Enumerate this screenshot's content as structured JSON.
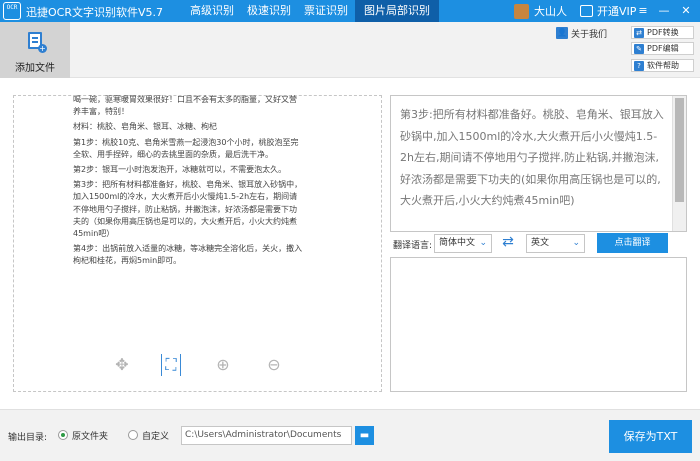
{
  "titlebar": {
    "logo": "OCR",
    "title": "迅捷OCR文字识别软件V5.7",
    "tabs": [
      {
        "label": "高级识别",
        "active": false
      },
      {
        "label": "极速识别",
        "active": false
      },
      {
        "label": "票证识别",
        "active": false
      },
      {
        "label": "图片局部识别",
        "active": true
      }
    ],
    "user_name": "大山人",
    "vip_label": "开通VIP",
    "window_buttons": [
      "menu-icon",
      "minimize-icon",
      "close-icon"
    ]
  },
  "toolbar": {
    "add_file_label": "添加文件",
    "contact_label": "关于我们",
    "pdf_convert_label": "PDF转换",
    "pdf_edit_label": "PDF编辑",
    "help_label": "软件帮助"
  },
  "source_image": {
    "paragraphs": [
      {
        "step": "",
        "text": "喝一碗，驱寒暖胃效果很好！口且不会有太多的脂量，又好又营养丰富，特别！"
      },
      {
        "step": "",
        "text": "材料：桃胶、皂角米、银耳、冰糖、枸杞"
      },
      {
        "step": "1",
        "text": "第1步：桃胶10克、皂角米雪燕一起浸泡30个小时，桃胶泡至完全软、用手捏碎，细心的去挑里面的杂质，最后洗干净。"
      },
      {
        "step": "2",
        "text": "第2步：银耳一小时泡发泡开，冰糖就可以，不需要泡太久。"
      },
      {
        "step": "3",
        "text": "第3步：把所有材料都准备好，桃胶、皂角米、银耳放入砂锅中，加入1500ml的冷水，大火煮开后小火慢炖1.5-2h左右，期间请不停地用勺子搅拌，防止粘锅，并撇泡沫，好浓汤都是需要下功夫的（如果你用高压锅也是可以的，大火煮开后，小火大约炖煮45min吧）"
      },
      {
        "step": "4",
        "text": "第4步：出锅前放入适量的冰糖，等冰糖完全溶化后，关火，撒入枸杞和桂花，再焖5min即可。"
      }
    ]
  },
  "image_tools": [
    "move-icon",
    "crop-icon",
    "zoom-in-icon",
    "zoom-out-icon"
  ],
  "result": {
    "text": "第3步:把所有材料都准备好。桃胶、皂角米、银耳放入砂锅中,加入1500ml的冷水,大火煮开后小火慢炖1.5-2h左右,期间请不停地用勺子搅拌,防止粘锅,并撇泡沫,好浓汤都是需要下功夫的(如果你用高压锅也是可以的,大火煮开后,小火大约炖煮45min吧)"
  },
  "translate": {
    "label": "翻译语言:",
    "source_lang": "简体中文",
    "target_lang": "英文",
    "button_label": "点击翻译",
    "output": ""
  },
  "bottom": {
    "output_dir_label": "输出目录:",
    "option_original": "原文件夹",
    "option_custom": "自定义",
    "selected": "original",
    "path": "C:\\Users\\Administrator\\Documents",
    "export_label": "保存为TXT"
  },
  "colors": {
    "primary": "#1d8fe1",
    "active_tab": "#0f5fa8",
    "radio_selected": "#2e9a45"
  }
}
